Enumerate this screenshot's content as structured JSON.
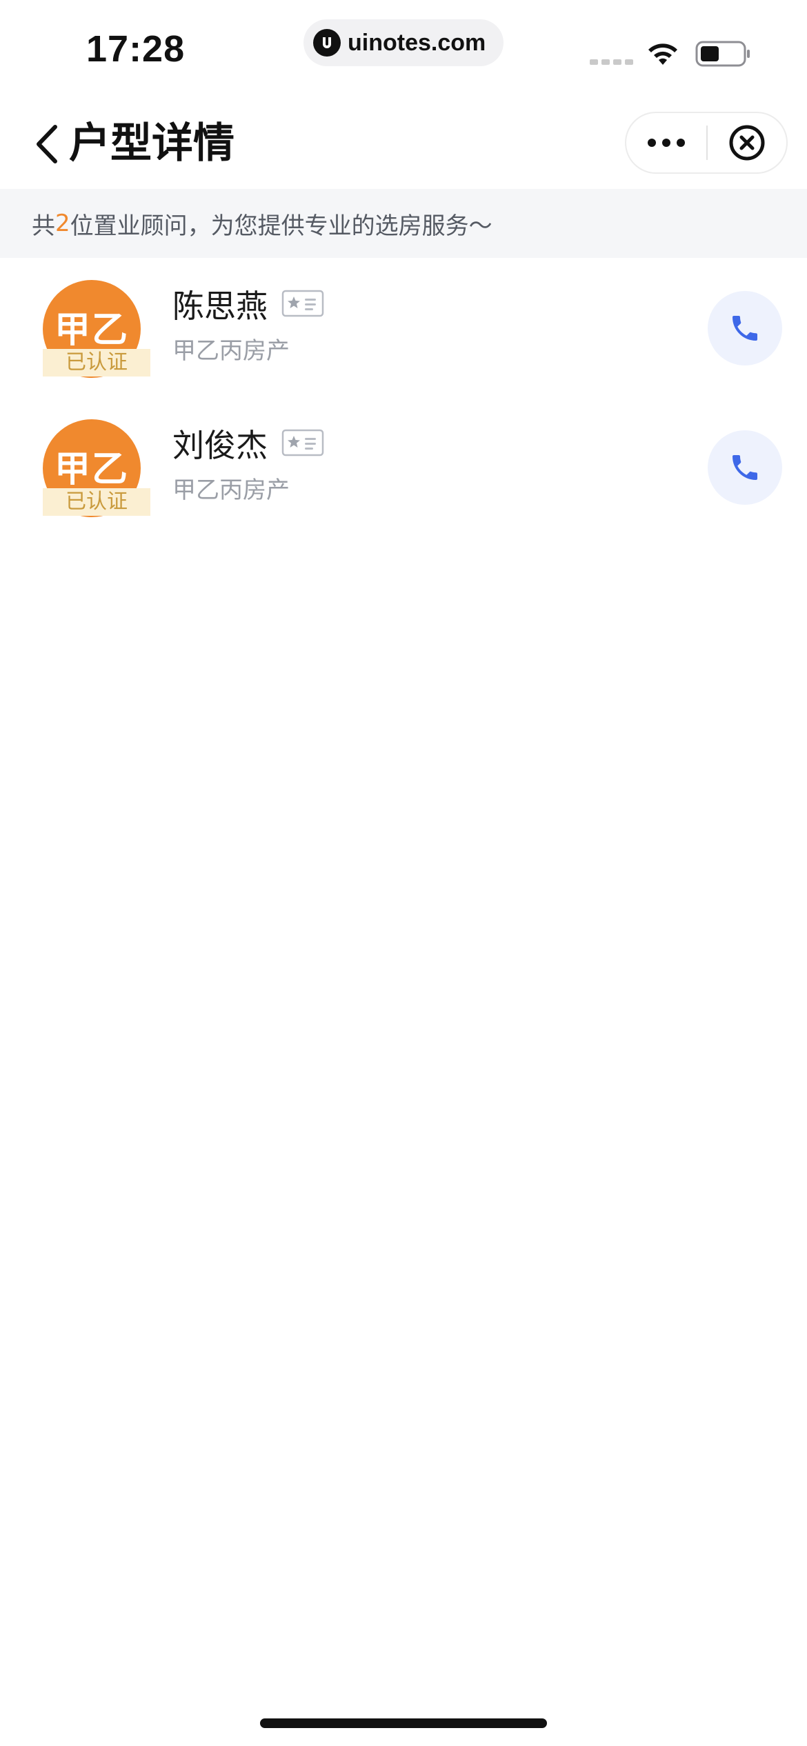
{
  "status_bar": {
    "time": "17:28",
    "url": "uinotes.com"
  },
  "nav": {
    "title": "户型详情"
  },
  "banner": {
    "prefix": "共",
    "count": "2",
    "suffix": "位置业顾问，为您提供专业的选房服务～"
  },
  "consultants": [
    {
      "avatar_text": "甲乙",
      "badge": "已认证",
      "name": "陈思燕",
      "company": "甲乙丙房产"
    },
    {
      "avatar_text": "甲乙",
      "badge": "已认证",
      "name": "刘俊杰",
      "company": "甲乙丙房产"
    }
  ],
  "colors": {
    "accent_orange": "#f0892e",
    "badge_bg": "#fbefd2",
    "badge_text": "#c99a3c",
    "call_blue": "#3e68e8",
    "call_bg": "#eef2fd",
    "banner_bg": "#f5f6f8"
  },
  "icons": {
    "back": "chevron-left-icon",
    "more": "more-dots-icon",
    "close": "close-circle-icon",
    "card": "business-card-icon",
    "phone": "phone-icon",
    "wifi": "wifi-icon",
    "battery": "battery-icon"
  }
}
